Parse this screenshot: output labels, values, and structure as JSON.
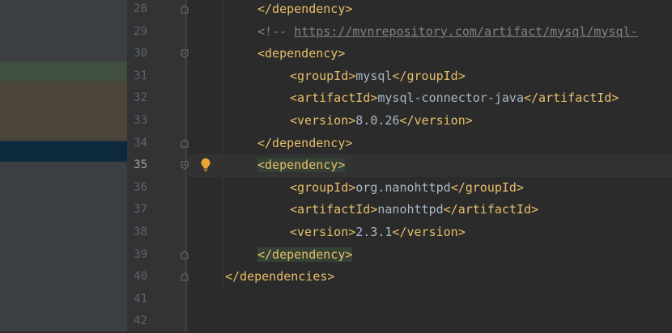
{
  "editor": {
    "lines": [
      {
        "num": "28",
        "segments": [
          {
            "type": "tag",
            "text": "</dependency>"
          }
        ]
      },
      {
        "num": "29",
        "segments": [
          {
            "type": "comment",
            "text": "<!-- "
          },
          {
            "type": "link",
            "text": "https://mvnrepository.com/artifact/mysql/mysql-"
          }
        ]
      },
      {
        "num": "30",
        "segments": [
          {
            "type": "tag",
            "text": "<dependency>"
          }
        ]
      },
      {
        "num": "31",
        "segments": [
          {
            "type": "tag",
            "text": "<groupId>"
          },
          {
            "type": "plain",
            "text": "mysql"
          },
          {
            "type": "tag",
            "text": "</groupId>"
          }
        ]
      },
      {
        "num": "32",
        "segments": [
          {
            "type": "tag",
            "text": "<artifactId>"
          },
          {
            "type": "plain",
            "text": "mysql-connector-java"
          },
          {
            "type": "tag",
            "text": "</artifactId>"
          }
        ]
      },
      {
        "num": "33",
        "segments": [
          {
            "type": "tag",
            "text": "<version>"
          },
          {
            "type": "plain",
            "text": "8.0.26"
          },
          {
            "type": "tag",
            "text": "</version>"
          }
        ]
      },
      {
        "num": "34",
        "segments": [
          {
            "type": "tag",
            "text": "</dependency>"
          }
        ]
      },
      {
        "num": "35",
        "segments": [
          {
            "type": "tag",
            "text": "<dependency>"
          }
        ]
      },
      {
        "num": "36",
        "segments": [
          {
            "type": "tag",
            "text": "<groupId>"
          },
          {
            "type": "plain",
            "text": "org.nanohttpd"
          },
          {
            "type": "tag",
            "text": "</groupId>"
          }
        ]
      },
      {
        "num": "37",
        "segments": [
          {
            "type": "tag",
            "text": "<artifactId>"
          },
          {
            "type": "plain",
            "text": "nanohttpd"
          },
          {
            "type": "tag",
            "text": "</artifactId>"
          }
        ]
      },
      {
        "num": "38",
        "segments": [
          {
            "type": "tag",
            "text": "<version>"
          },
          {
            "type": "plain",
            "text": "2.3.1"
          },
          {
            "type": "tag",
            "text": "</version>"
          }
        ]
      },
      {
        "num": "39",
        "segments": [
          {
            "type": "tag",
            "text": "</dependency>"
          }
        ]
      },
      {
        "num": "40",
        "segments": [
          {
            "type": "tag",
            "text": "</dependencies>"
          }
        ]
      },
      {
        "num": "41",
        "segments": []
      },
      {
        "num": "42",
        "segments": []
      }
    ],
    "current_line": "35",
    "intention_icon": "lightbulb-icon"
  }
}
